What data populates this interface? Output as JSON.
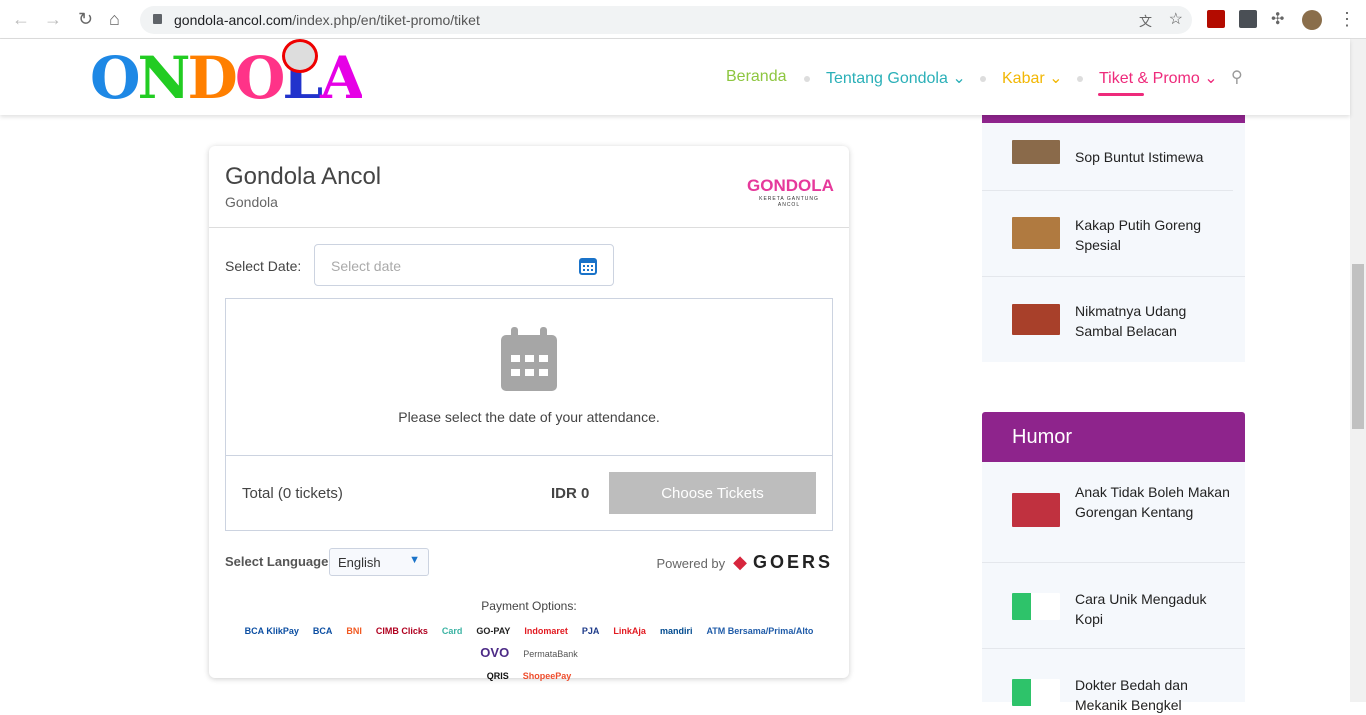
{
  "browser": {
    "url_domain": "gondola-ancol.com",
    "url_path": "/index.php/en/tiket-promo/tiket"
  },
  "header": {
    "logo": "GONDOLA",
    "menu": [
      {
        "label": "Beranda",
        "color": "#8dc63f"
      },
      {
        "label": "Tentang Gondola ⌄",
        "color": "#2bb0b8"
      },
      {
        "label": "Kabar ⌄",
        "color": "#f2b705"
      },
      {
        "label": "Tiket & Promo ⌄",
        "color": "#ee2a7b"
      }
    ]
  },
  "card": {
    "title": "Gondola Ancol",
    "subtitle": "Gondola",
    "logo": "GONDOLA",
    "logo_tag": "KERETA GANTUNG ANCOL",
    "select_date_label": "Select Date:",
    "date_placeholder": "Select date",
    "empty_message": "Please select the date of your attendance.",
    "total": "Total (0 tickets)",
    "amount": "IDR 0",
    "choose_button": "Choose Tickets",
    "language_label": "Select Language:",
    "language": "English",
    "powered_by": "Powered by",
    "powered_brand": "GOERS",
    "payment_label": "Payment Options:",
    "payments": [
      "BCA KlikPay",
      "BCA",
      "BNI",
      "CIMB Clicks",
      "Card",
      "GO-PAY",
      "Indomaret",
      "PJA",
      "LinkAja",
      "mandiri",
      "ATM Bersama/Prima/Alto",
      "OVO",
      "PermataBank",
      "QRIS",
      "ShopeePay"
    ]
  },
  "sidebar": {
    "food_items": [
      "Sop Buntut Istimewa",
      "Kakap Putih Goreng Spesial",
      "Nikmatnya Udang Sambal Belacan"
    ],
    "humor_title": "Humor",
    "humor_items": [
      "Anak Tidak Boleh Makan Gorengan Kentang",
      "Cara Unik Mengaduk Kopi",
      "Dokter Bedah dan Mekanik Bengkel"
    ],
    "accent": "#8e248c"
  }
}
